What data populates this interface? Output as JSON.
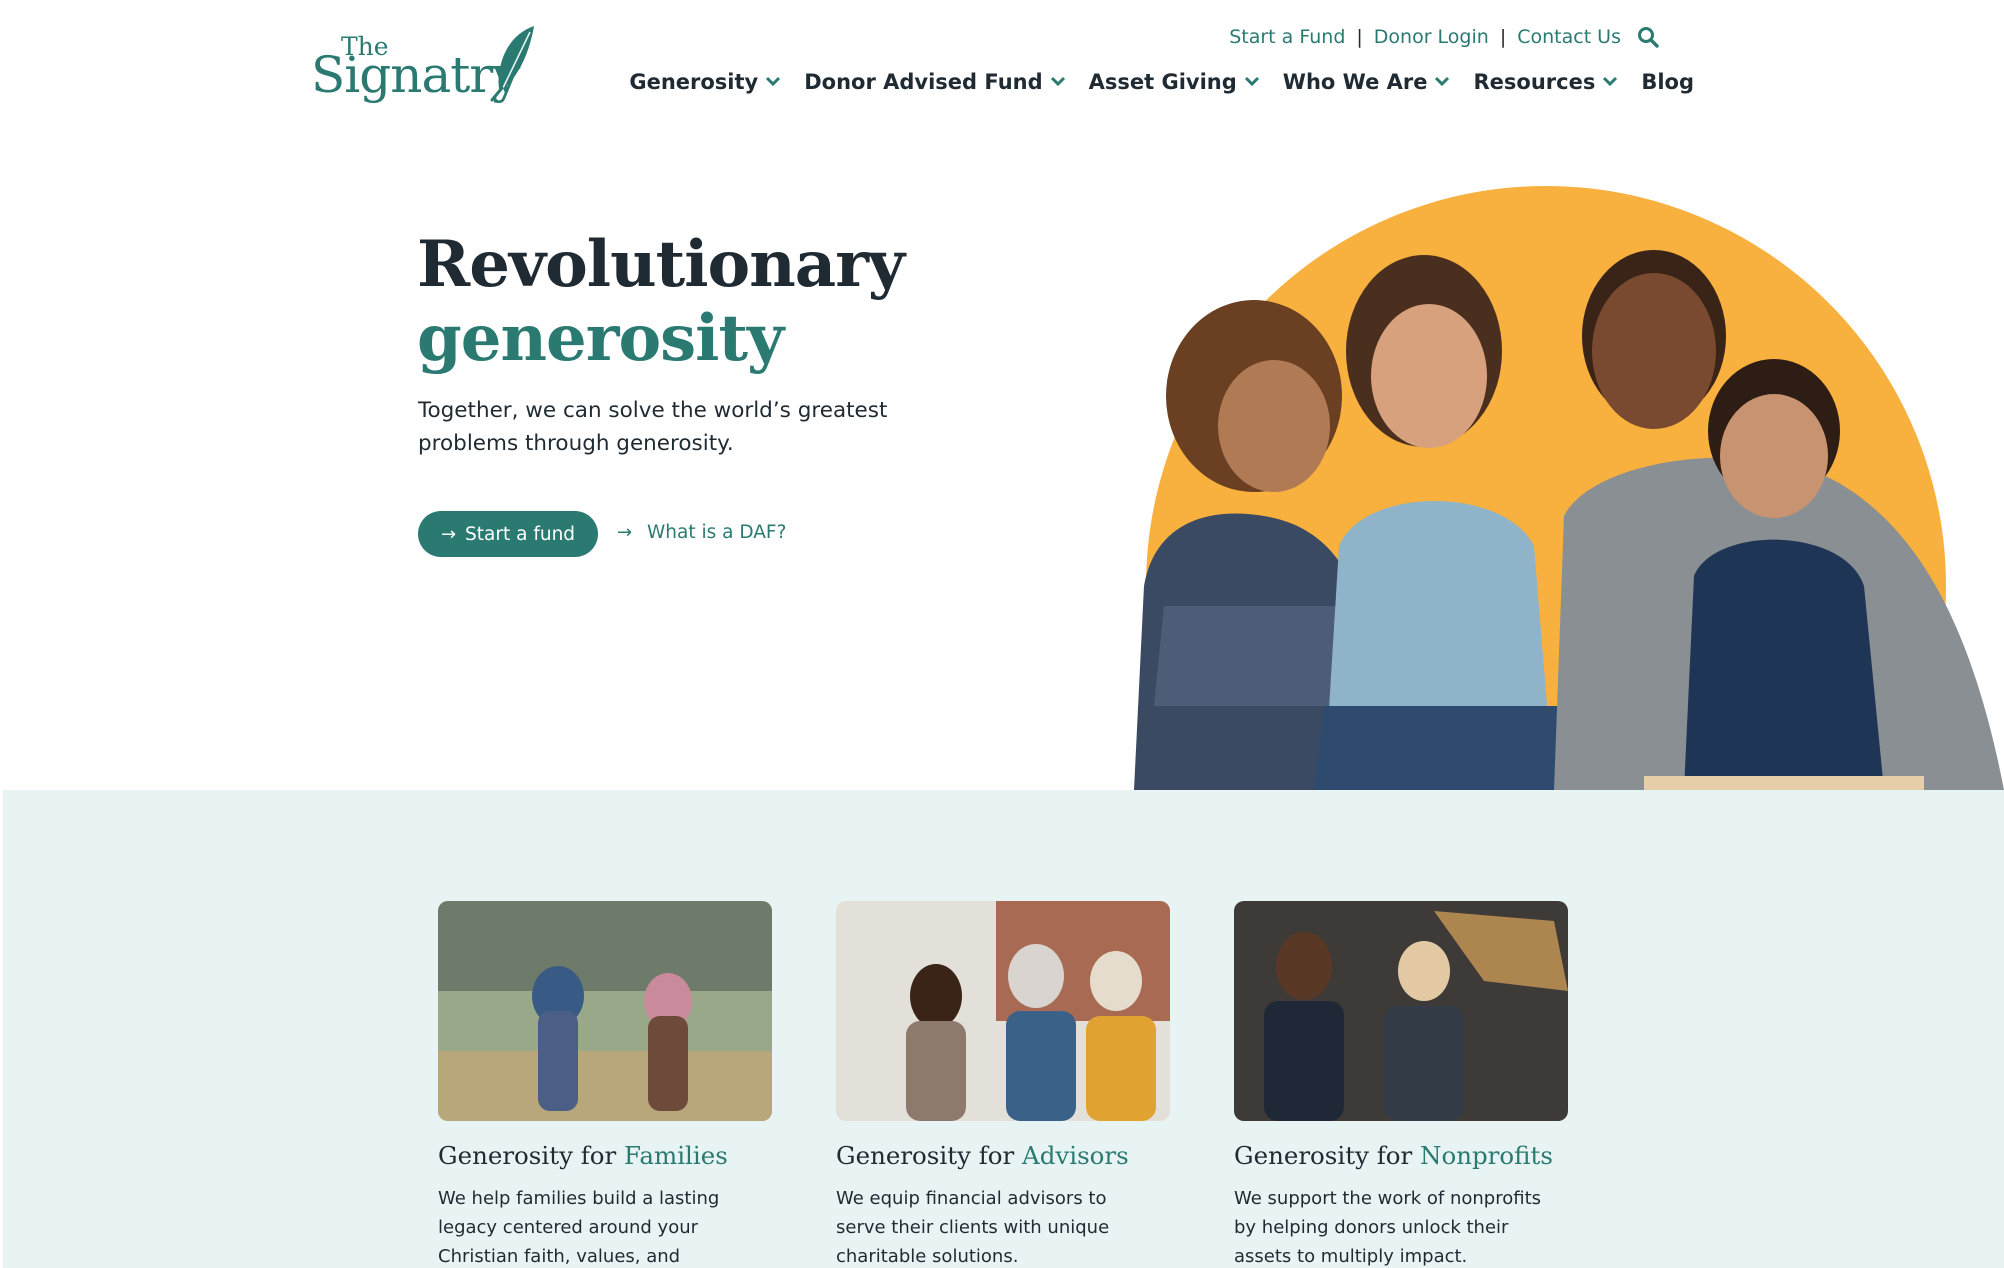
{
  "brand": {
    "logo_the": "The",
    "logo_name": "Signatry",
    "teal": "#2a7a72",
    "orange": "#f8b03e",
    "band_bg": "#e8f4f3"
  },
  "utility_nav": {
    "links": [
      "Start a Fund",
      "Donor Login",
      "Contact Us"
    ],
    "separator": "|",
    "search_icon": "search-icon"
  },
  "main_nav": {
    "items": [
      {
        "label": "Generosity",
        "has_dropdown": true
      },
      {
        "label": "Donor Advised Fund",
        "has_dropdown": true
      },
      {
        "label": "Asset Giving",
        "has_dropdown": true
      },
      {
        "label": "Who We Are",
        "has_dropdown": true
      },
      {
        "label": "Resources",
        "has_dropdown": true
      },
      {
        "label": "Blog",
        "has_dropdown": false
      }
    ]
  },
  "hero": {
    "title_line1": "Revolutionary",
    "title_line2": "generosity",
    "subtitle": "Together, we can solve the world’s greatest problems through generosity.",
    "primary_cta": "Start a fund",
    "secondary_cta": "What is a DAF?",
    "arrow": "→"
  },
  "cards": [
    {
      "title_prefix": "Generosity for",
      "title_accent": "Families",
      "description": "We help families build a lasting legacy centered around your Christian faith, values, and priorities."
    },
    {
      "title_prefix": "Generosity for",
      "title_accent": "Advisors",
      "description": "We equip financial advisors to serve their clients with unique charitable solutions."
    },
    {
      "title_prefix": "Generosity for",
      "title_accent": "Nonprofits",
      "description": "We support the work of nonprofits by helping donors unlock their assets to multiply impact."
    }
  ]
}
